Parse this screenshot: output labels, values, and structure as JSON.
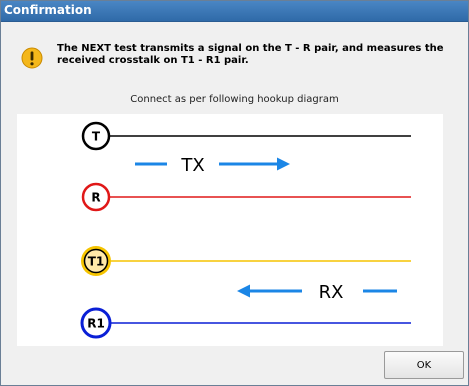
{
  "window": {
    "title": "Confirmation"
  },
  "message": {
    "icon": "warning-icon",
    "text": "The NEXT test transmits a signal on the T - R pair, and measures the received crosstalk on T1 - R1 pair."
  },
  "instruction": "Connect as per following hookup diagram",
  "diagram": {
    "pairs": [
      {
        "id": "t",
        "label": "T",
        "color": "#000000",
        "ring_fill": "#ffffff"
      },
      {
        "id": "r",
        "label": "R",
        "color": "#e01818",
        "ring_fill": "#ffffff"
      },
      {
        "id": "t1",
        "label": "T1",
        "color": "#f5c400",
        "ring_fill": "#ffe9a8"
      },
      {
        "id": "r1",
        "label": "R1",
        "color": "#0a1fd6",
        "ring_fill": "#ffffff"
      }
    ],
    "tx_label": "TX",
    "rx_label": "RX",
    "arrow_color": "#1b86e6"
  },
  "buttons": {
    "ok": "OK"
  }
}
